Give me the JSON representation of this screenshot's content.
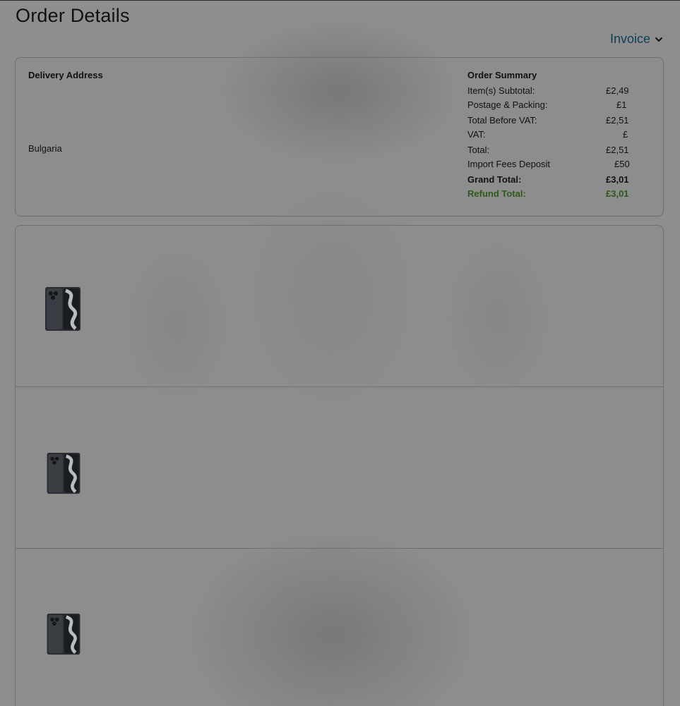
{
  "page": {
    "title": "Order Details",
    "invoice_label": "Invoice"
  },
  "delivery": {
    "heading": "Delivery Address",
    "country": "Bulgaria"
  },
  "order_summary": {
    "heading": "Order Summary",
    "rows": [
      {
        "label": "Item(s) Subtotal:",
        "value": "£2,49"
      },
      {
        "label": "Postage & Packing:",
        "value": "£1"
      },
      {
        "label": "Total Before VAT:",
        "value": "£2,51"
      },
      {
        "label": "VAT:",
        "value": "£"
      },
      {
        "label": "Total:",
        "value": "£2,51"
      },
      {
        "label": "Import Fees Deposit",
        "value": "£50"
      },
      {
        "label": "Grand Total:",
        "value": "£3,01"
      },
      {
        "label": "Refund Total:",
        "value": "£3,01"
      }
    ]
  },
  "items": [
    {
      "image": "phone-icon"
    },
    {
      "image": "phone-icon"
    },
    {
      "image": "phone-icon"
    }
  ],
  "colors": {
    "background": "#8e8e8e",
    "invoice_link": "#0c3f4f",
    "refund_text": "#2c5a1a"
  }
}
